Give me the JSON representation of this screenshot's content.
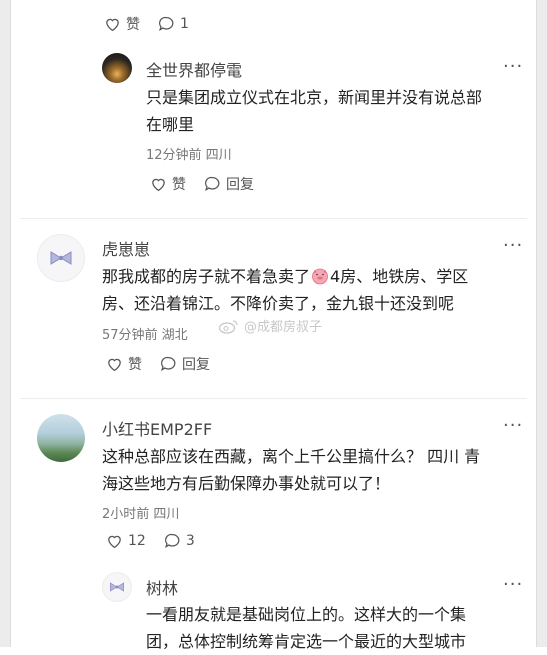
{
  "top_actions": {
    "like": "赞",
    "comment_count": "1"
  },
  "comments": [
    {
      "user": "全世界都停電",
      "avatar_icon": "sunset-photo-avatar",
      "lines": [
        "只是集团成立仪式在北京，新闻里并没有说总部",
        "在哪里"
      ],
      "meta": "12分钟前 四川",
      "like": "赞",
      "reply": "回复"
    },
    {
      "user": "虎崽崽",
      "avatar_icon": "bow-avatar",
      "line1_a": "那我成都的房子就不着急卖了",
      "line1_b": "4房、地铁房、学区",
      "line2": "房、还沿着锦江。不降价卖了，金九银十还没到呢",
      "meta": "57分钟前 湖北",
      "like": "赞",
      "reply": "回复"
    },
    {
      "user": "小红书EMP2FF",
      "avatar_icon": "landscape-photo-avatar",
      "lines": [
        "这种总部应该在西藏，离个上千公里搞什么？ 四川 青",
        "海这些地方有后勤保障办事处就可以了！"
      ],
      "meta": "2小时前 四川",
      "like_count": "12",
      "comment_count": "3"
    },
    {
      "user": "树林",
      "avatar_icon": "bow-avatar",
      "lines": [
        "一看朋友就是基础岗位上的。这样大的一个集",
        "团，总体控制统筹肯定选一个最近的大型城市"
      ]
    }
  ],
  "watermark": "@成都房叔子"
}
